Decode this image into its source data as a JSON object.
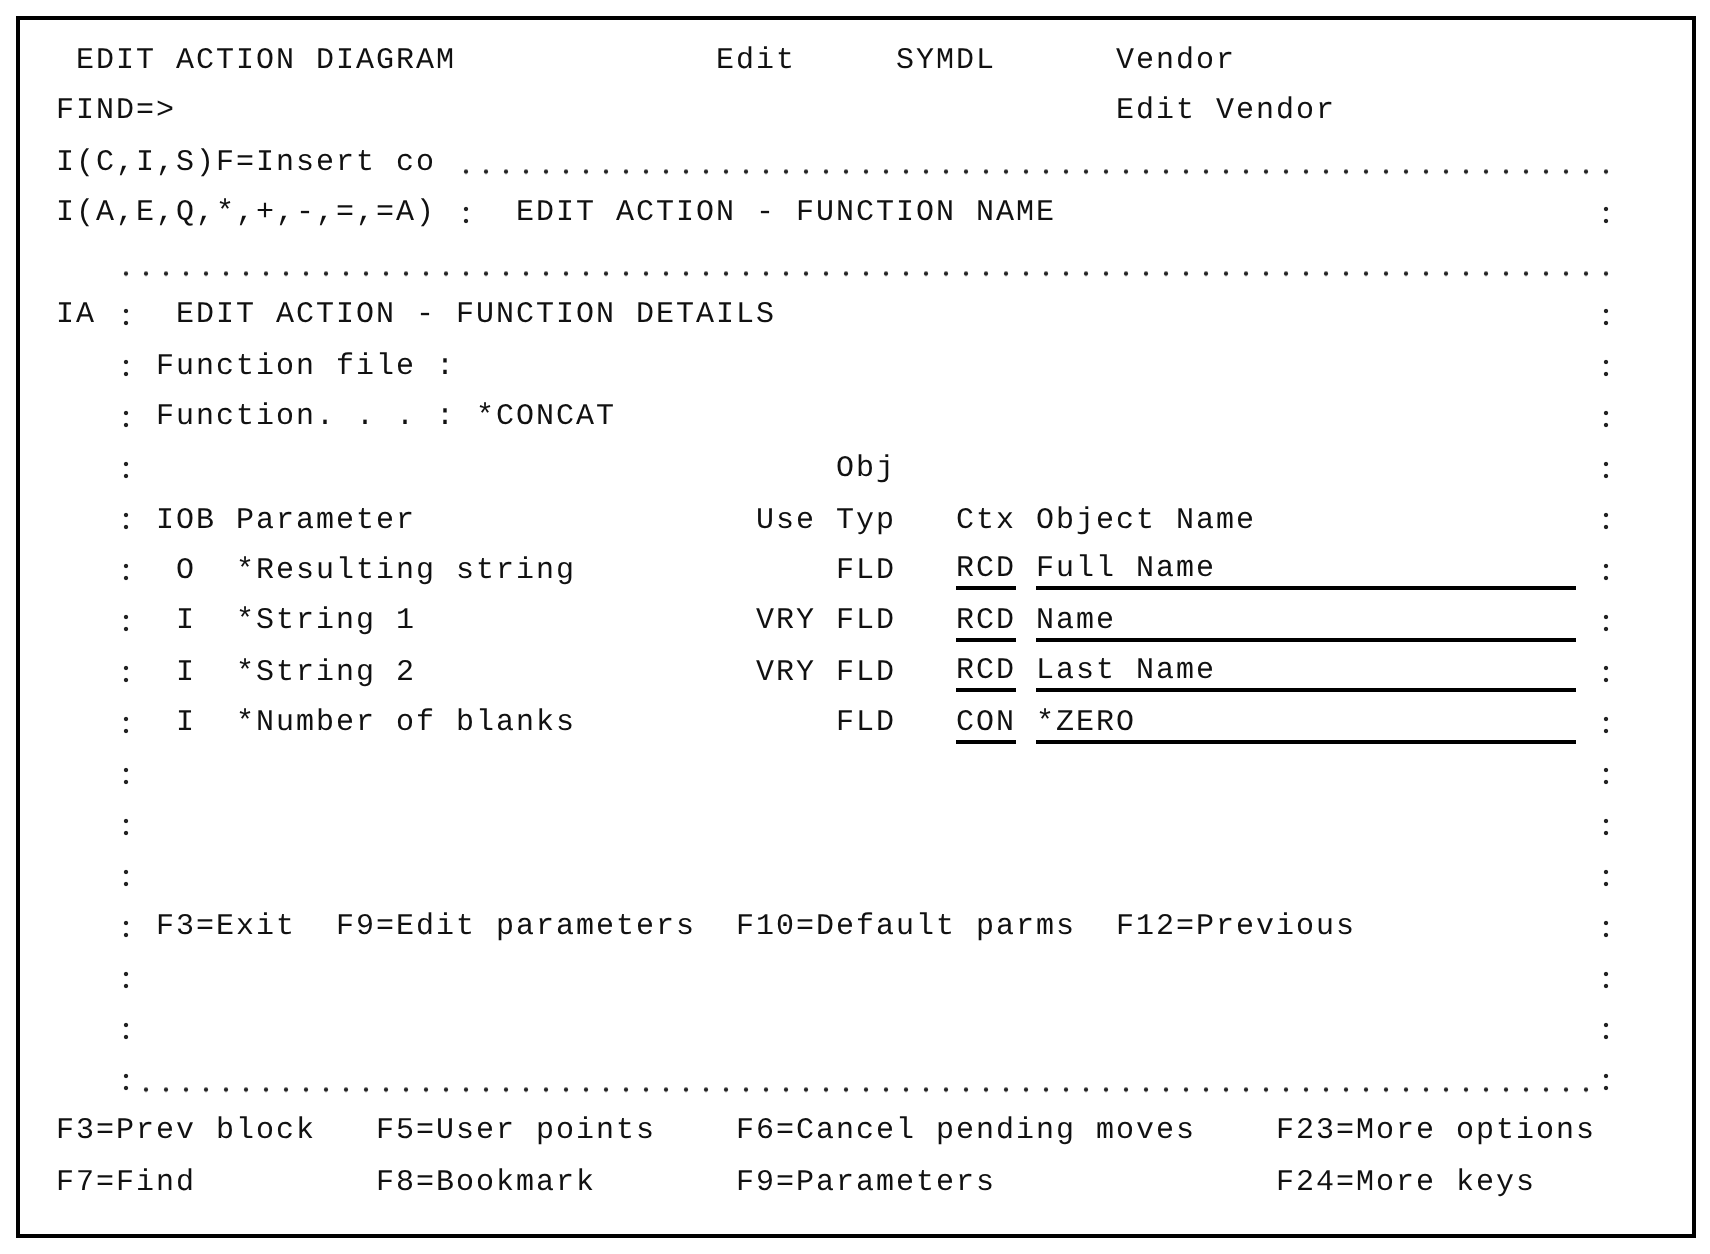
{
  "header": {
    "title": "EDIT ACTION DIAGRAM",
    "mode": "Edit",
    "model": "SYMDL",
    "file": "Vendor",
    "find_prompt": "FIND=>",
    "function": "Edit Vendor"
  },
  "line_command": "I(C,I,S)F=Insert co",
  "function_name_window": {
    "options": "I(A,E,Q,*,+,-,=,=A)",
    "title": "EDIT ACTION - FUNCTION NAME"
  },
  "function_details_window": {
    "option": "IA",
    "title": "EDIT ACTION - FUNCTION DETAILS",
    "fields": [
      {
        "label": "Function file :"
      },
      {
        "label": "Function. . . :",
        "value": "*CONCAT"
      }
    ],
    "columns": [
      {
        "lines": [
          "IOB"
        ]
      },
      {
        "lines": [
          "Parameter"
        ]
      },
      {
        "lines": [
          "Use"
        ]
      },
      {
        "lines": [
          "Obj",
          "Typ"
        ]
      },
      {
        "lines": [
          "Ctx"
        ]
      },
      {
        "lines": [
          "Object Name"
        ]
      }
    ],
    "parameters": [
      {
        "iob": "O",
        "parameter": "*Resulting string",
        "typ": "FLD",
        "ctx": "RCD",
        "object_name": "Full Name"
      },
      {
        "iob": "I",
        "parameter": "*String 1",
        "use": "VRY",
        "typ": "FLD",
        "ctx": "RCD",
        "object_name": "Name"
      },
      {
        "iob": "I",
        "parameter": "*String 2",
        "use": "VRY",
        "typ": "FLD",
        "ctx": "RCD",
        "object_name": "Last Name"
      },
      {
        "iob": "I",
        "parameter": "*Number of blanks",
        "typ": "FLD",
        "ctx": "CON",
        "object_name": "*ZERO"
      }
    ],
    "commands": [
      "F3=Exit",
      "F9=Edit parameters",
      "F10=Default parms",
      "F12=Previous"
    ]
  },
  "function_keys": [
    [
      "F3=Prev block",
      "F5=User points",
      "F6=Cancel pending moves",
      "F23=More options"
    ],
    [
      "F7=Find",
      "F8=Bookmark",
      "F9=Parameters",
      "F24=More keys"
    ]
  ]
}
